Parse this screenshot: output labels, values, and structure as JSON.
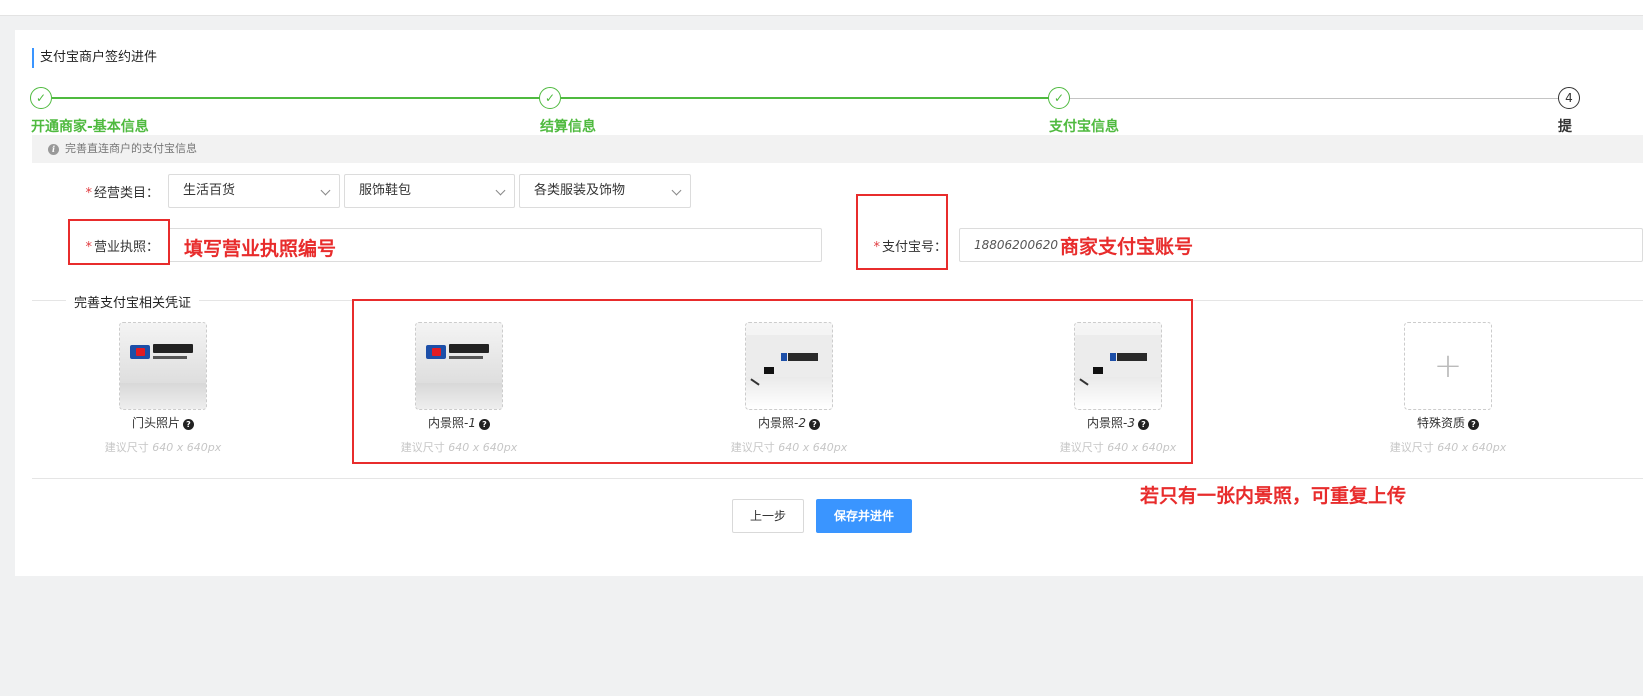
{
  "card_title": "支付宝商户签约进件",
  "steps": [
    {
      "label": "开通商家-基本信息",
      "status": "done"
    },
    {
      "label": "结算信息",
      "status": "done"
    },
    {
      "label": "支付宝信息",
      "status": "done"
    },
    {
      "label": "提",
      "number": "4",
      "status": "current"
    }
  ],
  "step_icon": "✓",
  "notice": {
    "icon": "info-icon",
    "text": "完善直连商户的支付宝信息"
  },
  "form": {
    "required_mark": "*",
    "category_label": "经营类目：",
    "category_values": [
      "生活百货",
      "服饰鞋包",
      "各类服装及饰物"
    ],
    "license_label": "营业执照：",
    "license_value": "",
    "alipay_label": "支付宝号：",
    "alipay_value": "18806200620"
  },
  "section_title": "完善支付宝相关凭证",
  "uploads": [
    {
      "label": "门头照片",
      "num": "",
      "hint_text": "建议尺寸",
      "hint_size": "640 x 640px",
      "image": "logo-wall-photo"
    },
    {
      "label": "内景照-",
      "num": "1",
      "hint_text": "建议尺寸",
      "hint_size": "640 x 640px",
      "image": "logo-wall-photo"
    },
    {
      "label": "内景照-",
      "num": "2",
      "hint_text": "建议尺寸",
      "hint_size": "640 x 640px",
      "image": "office-interior-photo"
    },
    {
      "label": "内景照-",
      "num": "3",
      "hint_text": "建议尺寸",
      "hint_size": "640 x 640px",
      "image": "office-interior-photo"
    },
    {
      "label": "特殊资质",
      "num": "",
      "hint_text": "建议尺寸",
      "hint_size": "640 x 640px",
      "image": "plus-icon"
    }
  ],
  "question_icon": "?",
  "plus_glyph": "+",
  "annotations": {
    "license_note": "填写营业执照编号",
    "alipay_note": "商家支付宝账号",
    "upload_note": "若只有一张内景照，可重复上传"
  },
  "buttons": {
    "prev": "上一步",
    "save": "保存并进件"
  },
  "colors": {
    "accent": "#3a95ff",
    "success": "#4fba3f",
    "annotation": "#e82c2c",
    "required": "#e0393e"
  }
}
